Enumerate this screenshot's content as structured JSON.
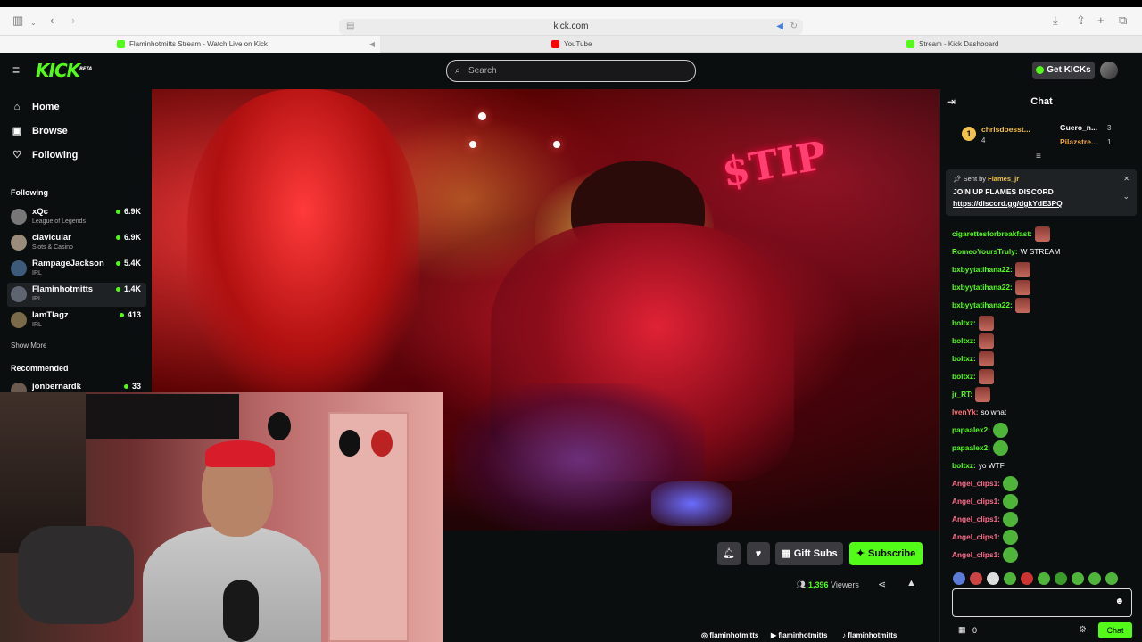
{
  "browser": {
    "url": "kick.com",
    "tabs": [
      {
        "title": "Flaminhotmitts Stream - Watch Live on Kick",
        "color": "#53fc18"
      },
      {
        "title": "YouTube",
        "color": "#ff0000"
      },
      {
        "title": "Stream - Kick Dashboard",
        "color": "#53fc18"
      }
    ]
  },
  "header": {
    "logo": "KICK",
    "logo_badge": "BETA",
    "search_placeholder": "Search",
    "get_kicks": "Get KICKs"
  },
  "sidebar": {
    "nav": [
      {
        "label": "Home",
        "icon": "home-icon"
      },
      {
        "label": "Browse",
        "icon": "browse-icon"
      },
      {
        "label": "Following",
        "icon": "heart-icon"
      }
    ],
    "following_title": "Following",
    "following": [
      {
        "name": "xQc",
        "category": "League of Legends",
        "viewers": "6.9K"
      },
      {
        "name": "clavicular",
        "category": "Slots & Casino",
        "viewers": "6.9K"
      },
      {
        "name": "RampageJackson",
        "category": "IRL",
        "viewers": "5.4K"
      },
      {
        "name": "Flaminhotmitts",
        "category": "IRL",
        "viewers": "1.4K"
      },
      {
        "name": "IamTlagz",
        "category": "IRL",
        "viewers": "413"
      }
    ],
    "show_more": "Show More",
    "recommended_title": "Recommended",
    "recommended": [
      {
        "name": "jonbernardk",
        "viewers": "33"
      }
    ]
  },
  "video": {
    "sign_text": "TIP"
  },
  "stream_info": {
    "gift_subs": "Gift Subs",
    "subscribe": "Subscribe",
    "viewers_count": "1,396",
    "viewers_label": "Viewers",
    "socials": [
      "flaminhotmitts",
      "flaminhotmitts",
      "flaminhotmitts"
    ]
  },
  "chat": {
    "title": "Chat",
    "leaderboard": [
      {
        "rank": "1",
        "name": "chrisdoesst...",
        "count": "4"
      },
      {
        "name": "Guero_n...",
        "count": "3"
      },
      {
        "name": "Pilazstre...",
        "count": "1"
      }
    ],
    "pinned": {
      "sent_by_label": "Sent by",
      "sender": "Flames_jr",
      "text": "JOIN UP FLAMES DISCORD",
      "link": "https://discord.gg/dgkYdE3PQ"
    },
    "messages": [
      {
        "user": "cigarettesforbreakfast:",
        "text": "",
        "color": "#53fc18",
        "emote": "face"
      },
      {
        "user": "RomeoYoursTruly:",
        "text": "W STREAM",
        "color": "#53fc18",
        "emote": ""
      },
      {
        "user": "bxbyytatihana22:",
        "text": "",
        "color": "#53fc18",
        "emote": "face"
      },
      {
        "user": "bxbyytatihana22:",
        "text": "",
        "color": "#53fc18",
        "emote": "face"
      },
      {
        "user": "bxbyytatihana22:",
        "text": "",
        "color": "#53fc18",
        "emote": "face"
      },
      {
        "user": "boltxz:",
        "text": "",
        "color": "#53fc18",
        "emote": "face"
      },
      {
        "user": "boltxz:",
        "text": "",
        "color": "#53fc18",
        "emote": "face"
      },
      {
        "user": "boltxz:",
        "text": "",
        "color": "#53fc18",
        "emote": "face"
      },
      {
        "user": "boltxz:",
        "text": "",
        "color": "#53fc18",
        "emote": "face"
      },
      {
        "user": "jr_RT:",
        "text": "",
        "color": "#53fc18",
        "emote": "face"
      },
      {
        "user": "IvenYk:",
        "text": "so what",
        "color": "#ff7070",
        "emote": ""
      },
      {
        "user": "papaalex2:",
        "text": "",
        "color": "#53fc18",
        "emote": "pepe"
      },
      {
        "user": "papaalex2:",
        "text": "",
        "color": "#53fc18",
        "emote": "pepe"
      },
      {
        "user": "boltxz:",
        "text": "yo WTF",
        "color": "#53fc18",
        "emote": ""
      },
      {
        "user": "Angel_clips1:",
        "text": "",
        "color": "#ff6b8a",
        "emote": "pepe"
      },
      {
        "user": "Angel_clips1:",
        "text": "",
        "color": "#ff6b8a",
        "emote": "pepe"
      },
      {
        "user": "Angel_clips1:",
        "text": "",
        "color": "#ff6b8a",
        "emote": "pepe"
      },
      {
        "user": "Angel_clips1:",
        "text": "",
        "color": "#ff6b8a",
        "emote": "pepe"
      },
      {
        "user": "Angel_clips1:",
        "text": "",
        "color": "#ff6b8a",
        "emote": "pepe"
      }
    ],
    "input_value": "",
    "kicks_count": "0",
    "send_label": "Chat"
  },
  "colors": {
    "accent": "#53fc18",
    "background": "#0b0e0f"
  }
}
